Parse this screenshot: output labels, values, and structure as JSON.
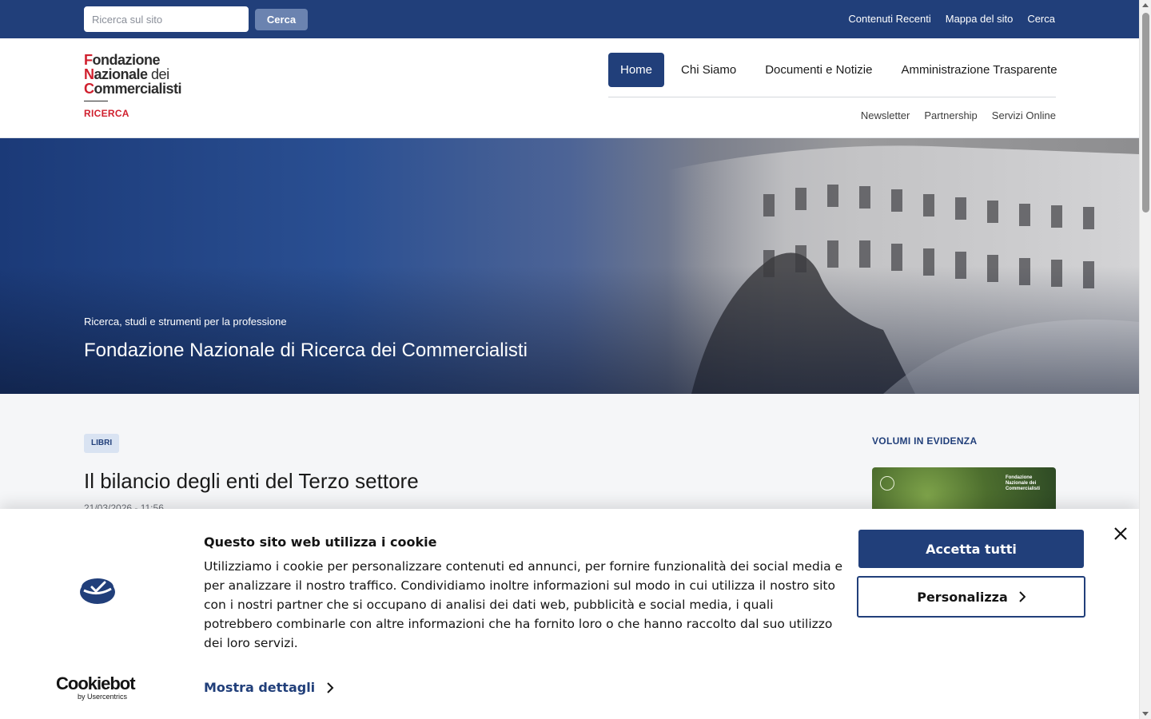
{
  "topbar": {
    "search_placeholder": "Ricerca sul sito",
    "search_button": "Cerca",
    "links": [
      "Contenuti Recenti",
      "Mappa del sito",
      "Cerca"
    ]
  },
  "logo": {
    "line1_rest": "ondazione",
    "line2_rest": "azionale",
    "line2_dei": "dei",
    "line3_rest": "ommercialisti",
    "initial1": "F",
    "initial2": "N",
    "initial3": "C",
    "sub": "RICERCA"
  },
  "nav": {
    "items": [
      "Home",
      "Chi Siamo",
      "Documenti e Notizie",
      "Amministrazione Trasparente"
    ],
    "active": "Home",
    "subitems": [
      "Newsletter",
      "Partnership",
      "Servizi Online"
    ]
  },
  "hero": {
    "tagline": "Ricerca, studi e strumenti per la professione",
    "title": "Fondazione Nazionale di Ricerca dei Commercialisti"
  },
  "article": {
    "badge": "LIBRI",
    "title": "Il bilancio degli enti del Terzo settore",
    "date": "21/03/2026 - 11:56"
  },
  "sidebar": {
    "title": "VOLUMI IN EVIDENZA",
    "book_right": [
      "Fondazione",
      "Nazionale dei",
      "Commercialisti"
    ]
  },
  "cookie": {
    "title": "Questo sito web utilizza i cookie",
    "text": "Utilizziamo i cookie per personalizzare contenuti ed annunci, per fornire funzionalità dei social media e per analizzare il nostro traffico. Condividiamo inoltre informazioni sul modo in cui utilizza il nostro sito con i nostri partner che si occupano di analisi dei dati web, pubblicità e social media, i quali potrebbero combinarle con altre informazioni che ha fornito loro o che hanno raccolto dal suo utilizzo dei loro servizi.",
    "details": "Mostra dettagli",
    "accept": "Accetta tutti",
    "customize": "Personalizza",
    "brand": "Cookiebot",
    "brand_sub": "by Usercentrics"
  },
  "colors": {
    "primary": "#213f7a",
    "accent_red": "#d0202e"
  }
}
